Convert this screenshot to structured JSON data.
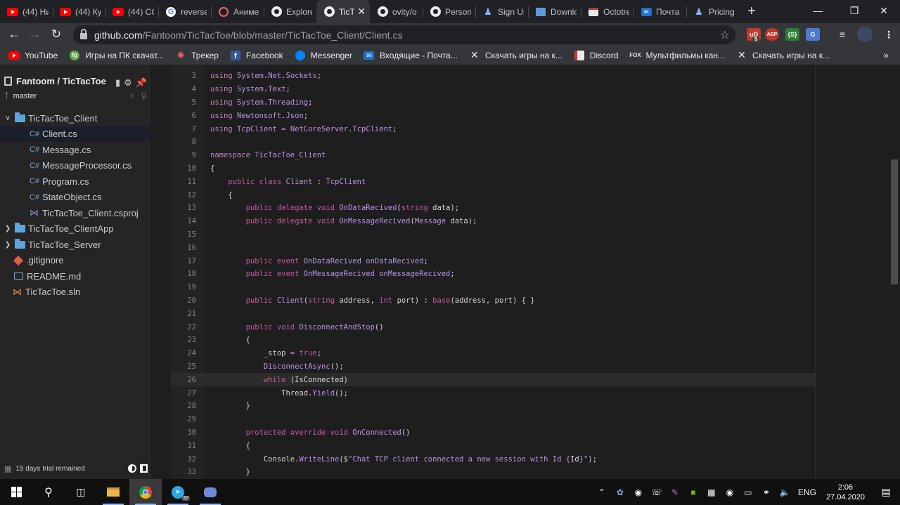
{
  "browser": {
    "tabs": [
      {
        "label": "(44) Ни",
        "icon": "youtube-icon"
      },
      {
        "label": "(44) Ку",
        "icon": "youtube-icon"
      },
      {
        "label": "(44) CO",
        "icon": "youtube-icon"
      },
      {
        "label": "reverse",
        "icon": "google-icon"
      },
      {
        "label": "Аниме",
        "icon": "anime-site-icon"
      },
      {
        "label": "Explore",
        "icon": "github-icon"
      },
      {
        "label": "TicT",
        "icon": "github-icon",
        "active": true
      },
      {
        "label": "ovity/o",
        "icon": "github-icon"
      },
      {
        "label": "Persona",
        "icon": "github-icon"
      },
      {
        "label": "Sign Up",
        "icon": "person-icon"
      },
      {
        "label": "Downlo",
        "icon": "download-icon"
      },
      {
        "label": "Octotre",
        "icon": "octotree-icon"
      },
      {
        "label": "Почта",
        "icon": "mail-icon"
      },
      {
        "label": "Pricing",
        "icon": "person-icon"
      }
    ],
    "new_tab": "+",
    "close_glyph": "✕",
    "url_host": "github.com",
    "url_path": "/Fantoom/TicTacToe/blob/master/TicTacToe_Client/Client.cs",
    "extensions": {
      "ud_badge": "9",
      "abp": "ABP",
      "json": "{S}"
    },
    "bookmarks": [
      {
        "label": "YouTube",
        "icon": "youtube-icon"
      },
      {
        "label": "Игры на ПК скачат...",
        "icon": "fg-icon"
      },
      {
        "label": "Трекер",
        "icon": "tracker-icon"
      },
      {
        "label": "Facebook",
        "icon": "facebook-icon"
      },
      {
        "label": "Messenger",
        "icon": "messenger-icon"
      },
      {
        "label": "Входящие - Почта...",
        "icon": "mail-icon"
      },
      {
        "label": "Скачать игры на к...",
        "icon": "x-icon"
      },
      {
        "label": "Discord",
        "icon": "discord-icon"
      },
      {
        "label": "Мультфильмы кан...",
        "icon": "fox-icon"
      },
      {
        "label": "Скачать игры на к...",
        "icon": "x-icon"
      }
    ]
  },
  "sidebar": {
    "repo": "Fantoom / TicTacToe",
    "branch": "master",
    "tree": [
      {
        "label": "TicTacToe_Client",
        "kind": "folder-open",
        "depth": 0
      },
      {
        "label": "Client.cs",
        "kind": "cs",
        "depth": 1,
        "selected": true
      },
      {
        "label": "Message.cs",
        "kind": "cs",
        "depth": 1
      },
      {
        "label": "MessageProcessor.cs",
        "kind": "cs",
        "depth": 1
      },
      {
        "label": "Program.cs",
        "kind": "cs",
        "depth": 1
      },
      {
        "label": "StateObject.cs",
        "kind": "cs",
        "depth": 1
      },
      {
        "label": "TicTacToe_Client.csproj",
        "kind": "csproj",
        "depth": 1
      },
      {
        "label": "TicTacToe_ClientApp",
        "kind": "folder",
        "depth": 0
      },
      {
        "label": "TicTacToe_Server",
        "kind": "folder",
        "depth": 0
      },
      {
        "label": ".gitignore",
        "kind": "git",
        "depth": 0
      },
      {
        "label": "README.md",
        "kind": "md",
        "depth": 0
      },
      {
        "label": "TicTacToe.sln",
        "kind": "sln",
        "depth": 0
      }
    ],
    "footer": "15 days trial remained"
  },
  "code": {
    "highlight_line": 26,
    "lines": [
      {
        "n": "3",
        "t": [
          [
            "k",
            "using "
          ],
          [
            "ty",
            "System"
          ],
          [
            "id",
            "."
          ],
          [
            "ty",
            "Net"
          ],
          [
            "id",
            "."
          ],
          [
            "ty",
            "Sockets"
          ],
          [
            "id",
            ";"
          ]
        ]
      },
      {
        "n": "4",
        "t": [
          [
            "k",
            "using "
          ],
          [
            "ty",
            "System"
          ],
          [
            "id",
            "."
          ],
          [
            "ty",
            "Text"
          ],
          [
            "id",
            ";"
          ]
        ]
      },
      {
        "n": "5",
        "t": [
          [
            "k",
            "using "
          ],
          [
            "ty",
            "System"
          ],
          [
            "id",
            "."
          ],
          [
            "ty",
            "Threading"
          ],
          [
            "id",
            ";"
          ]
        ]
      },
      {
        "n": "6",
        "t": [
          [
            "k",
            "using "
          ],
          [
            "ty",
            "Newtonsoft"
          ],
          [
            "id",
            "."
          ],
          [
            "ty",
            "Json"
          ],
          [
            "id",
            ";"
          ]
        ]
      },
      {
        "n": "7",
        "t": [
          [
            "k",
            "using "
          ],
          [
            "ty",
            "TcpClient "
          ],
          [
            "op",
            "= "
          ],
          [
            "ty",
            "NetCoreServer"
          ],
          [
            "id",
            "."
          ],
          [
            "ty",
            "TcpClient"
          ],
          [
            "id",
            ";"
          ]
        ]
      },
      {
        "n": "8",
        "t": []
      },
      {
        "n": "9",
        "t": [
          [
            "k",
            "namespace "
          ],
          [
            "ty",
            "TicTacToe_Client"
          ]
        ]
      },
      {
        "n": "10",
        "t": [
          [
            "id",
            "{"
          ]
        ]
      },
      {
        "n": "11",
        "t": [
          [
            "id",
            "    "
          ],
          [
            "k2",
            "public class "
          ],
          [
            "ty",
            "Client "
          ],
          [
            "id",
            ": "
          ],
          [
            "ty",
            "TcpClient"
          ]
        ]
      },
      {
        "n": "12",
        "t": [
          [
            "id",
            "    {"
          ]
        ]
      },
      {
        "n": "13",
        "t": [
          [
            "id",
            "        "
          ],
          [
            "k2",
            "public delegate void "
          ],
          [
            "ty",
            "OnDataRecived"
          ],
          [
            "id",
            "("
          ],
          [
            "k2",
            "string "
          ],
          [
            "id",
            "data);"
          ]
        ]
      },
      {
        "n": "14",
        "t": [
          [
            "id",
            "        "
          ],
          [
            "k2",
            "public delegate void "
          ],
          [
            "ty",
            "OnMessageRecived"
          ],
          [
            "id",
            "("
          ],
          [
            "ty",
            "Message "
          ],
          [
            "id",
            "data);"
          ]
        ]
      },
      {
        "n": "15",
        "t": []
      },
      {
        "n": "16",
        "t": []
      },
      {
        "n": "17",
        "t": [
          [
            "id",
            "        "
          ],
          [
            "k2",
            "public event "
          ],
          [
            "ty",
            "OnDataRecived onDataRecived"
          ],
          [
            "id",
            ";"
          ]
        ]
      },
      {
        "n": "18",
        "t": [
          [
            "id",
            "        "
          ],
          [
            "k2",
            "public event "
          ],
          [
            "ty",
            "OnMessageRecived onMessageRecived"
          ],
          [
            "id",
            ";"
          ]
        ]
      },
      {
        "n": "19",
        "t": []
      },
      {
        "n": "20",
        "t": [
          [
            "id",
            "        "
          ],
          [
            "k2",
            "public "
          ],
          [
            "ty",
            "Client"
          ],
          [
            "id",
            "("
          ],
          [
            "k2",
            "string "
          ],
          [
            "id",
            "address, "
          ],
          [
            "k2",
            "int "
          ],
          [
            "id",
            "port) : "
          ],
          [
            "k2",
            "base"
          ],
          [
            "id",
            "(address, port) { }"
          ]
        ]
      },
      {
        "n": "21",
        "t": []
      },
      {
        "n": "22",
        "t": [
          [
            "id",
            "        "
          ],
          [
            "k2",
            "public void "
          ],
          [
            "ty",
            "DisconnectAndStop"
          ],
          [
            "id",
            "()"
          ]
        ]
      },
      {
        "n": "23",
        "t": [
          [
            "id",
            "        {"
          ]
        ]
      },
      {
        "n": "24",
        "t": [
          [
            "id",
            "            _stop "
          ],
          [
            "op",
            "= "
          ],
          [
            "k2",
            "true"
          ],
          [
            "id",
            ";"
          ]
        ]
      },
      {
        "n": "25",
        "t": [
          [
            "id",
            "            "
          ],
          [
            "ty",
            "DisconnectAsync"
          ],
          [
            "id",
            "();"
          ]
        ]
      },
      {
        "n": "26",
        "t": [
          [
            "id",
            "            "
          ],
          [
            "k2",
            "while "
          ],
          [
            "id",
            "(IsConnected)"
          ]
        ]
      },
      {
        "n": "27",
        "t": [
          [
            "id",
            "                Thread."
          ],
          [
            "ty",
            "Yield"
          ],
          [
            "id",
            "();"
          ]
        ]
      },
      {
        "n": "28",
        "t": [
          [
            "id",
            "        }"
          ]
        ]
      },
      {
        "n": "29",
        "t": []
      },
      {
        "n": "30",
        "t": [
          [
            "id",
            "        "
          ],
          [
            "k2",
            "protected override void "
          ],
          [
            "ty",
            "OnConnected"
          ],
          [
            "id",
            "()"
          ]
        ]
      },
      {
        "n": "31",
        "t": [
          [
            "id",
            "        {"
          ]
        ]
      },
      {
        "n": "32",
        "t": [
          [
            "id",
            "            Console."
          ],
          [
            "ty",
            "WriteLine"
          ],
          [
            "id",
            "($"
          ],
          [
            "ty",
            "\"Chat TCP client connected a new session with Id {"
          ],
          [
            "id",
            "Id"
          ],
          [
            "ty",
            "}\""
          ],
          [
            "id",
            ");"
          ]
        ]
      },
      {
        "n": "33",
        "t": [
          [
            "id",
            "        }"
          ]
        ]
      }
    ]
  },
  "taskbar": {
    "apps": [
      "search-icon",
      "task-view-icon",
      "file-explorer-icon",
      "chrome-icon",
      "telegram-icon",
      "discord-icon"
    ],
    "telegram_badge": "37",
    "language": "ENG",
    "time": "2:06",
    "date": "27.04.2020"
  },
  "colors": {
    "keyword": "#c75a9a",
    "type": "#b893e6",
    "identifier": "#d4d4d4",
    "line_number": "#858585"
  }
}
